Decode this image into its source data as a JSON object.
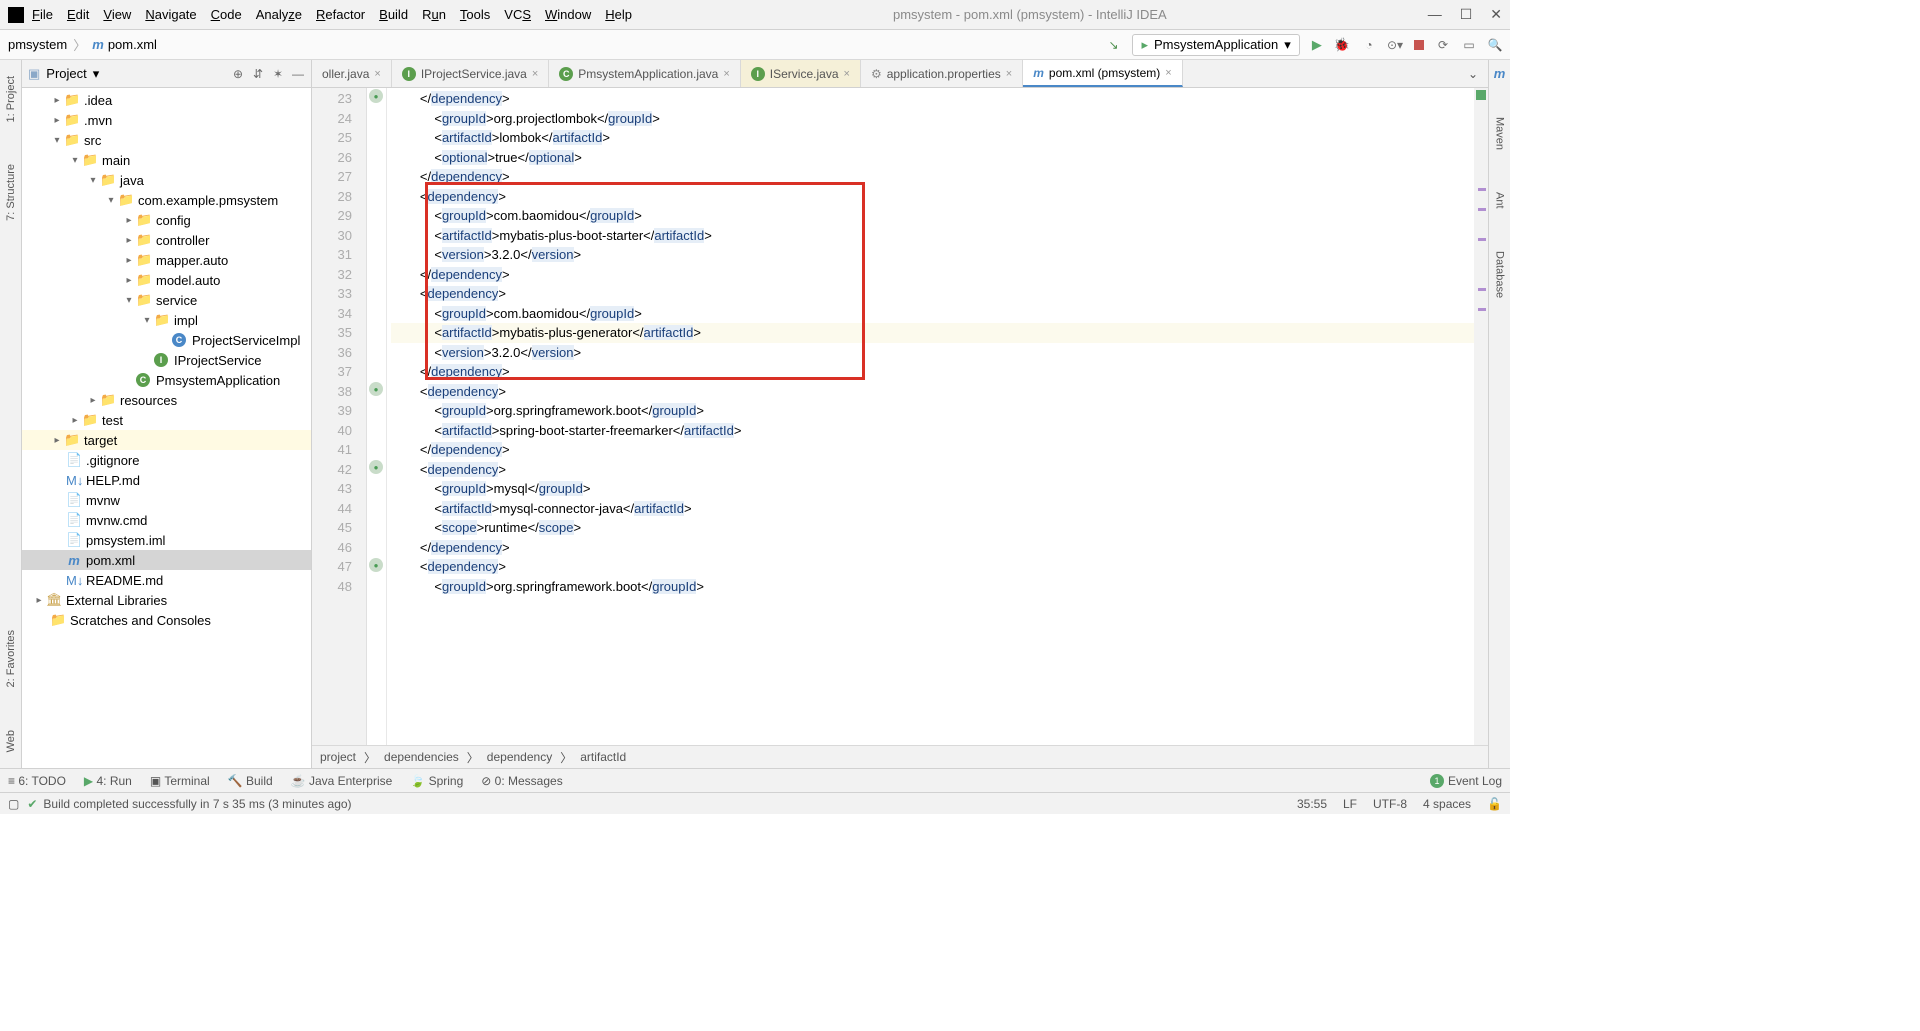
{
  "titlebar": {
    "title": "pmsystem - pom.xml (pmsystem) - IntelliJ IDEA",
    "menus": [
      "File",
      "Edit",
      "View",
      "Navigate",
      "Code",
      "Analyze",
      "Refactor",
      "Build",
      "Run",
      "Tools",
      "VCS",
      "Window",
      "Help"
    ]
  },
  "nav": {
    "crumb1": "pmsystem",
    "crumb2": "pom.xml",
    "run_config": "PmsystemApplication"
  },
  "project_panel": {
    "title": "Project"
  },
  "tree": {
    "idea": ".idea",
    "mvn": ".mvn",
    "src": "src",
    "main": "main",
    "java": "java",
    "pkg": "com.example.pmsystem",
    "config": "config",
    "controller": "controller",
    "mapper": "mapper.auto",
    "model": "model.auto",
    "service": "service",
    "impl": "impl",
    "psi": "ProjectServiceImpl",
    "ips": "IProjectService",
    "app": "PmsystemApplication",
    "resources": "resources",
    "test": "test",
    "target": "target",
    "gitignore": ".gitignore",
    "help": "HELP.md",
    "mvnw": "mvnw",
    "mvnwcmd": "mvnw.cmd",
    "iml": "pmsystem.iml",
    "pom": "pom.xml",
    "readme": "README.md",
    "extlib": "External Libraries",
    "scratch": "Scratches and Consoles"
  },
  "tabs": {
    "t1": "oller.java",
    "t2": "IProjectService.java",
    "t3": "PmsystemApplication.java",
    "t4": "IService.java",
    "t5": "application.properties",
    "t6": "pom.xml (pmsystem)"
  },
  "code_lines": [
    {
      "n": 23,
      "raw": "        </dependency>"
    },
    {
      "n": 24,
      "raw": "            <groupId>org.projectlombok</groupId>"
    },
    {
      "n": 25,
      "raw": "            <artifactId>lombok</artifactId>"
    },
    {
      "n": 26,
      "raw": "            <optional>true</optional>"
    },
    {
      "n": 27,
      "raw": "        </dependency>"
    },
    {
      "n": 28,
      "raw": "        <dependency>"
    },
    {
      "n": 29,
      "raw": "            <groupId>com.baomidou</groupId>"
    },
    {
      "n": 30,
      "raw": "            <artifactId>mybatis-plus-boot-starter</artifactId>"
    },
    {
      "n": 31,
      "raw": "            <version>3.2.0</version>"
    },
    {
      "n": 32,
      "raw": "        </dependency>"
    },
    {
      "n": 33,
      "raw": "        <dependency>"
    },
    {
      "n": 34,
      "raw": "            <groupId>com.baomidou</groupId>"
    },
    {
      "n": 35,
      "raw": "            <artifactId>mybatis-plus-generator</artifactId>",
      "hl": true
    },
    {
      "n": 36,
      "raw": "            <version>3.2.0</version>"
    },
    {
      "n": 37,
      "raw": "        </dependency>"
    },
    {
      "n": 38,
      "raw": "        <dependency>"
    },
    {
      "n": 39,
      "raw": "            <groupId>org.springframework.boot</groupId>"
    },
    {
      "n": 40,
      "raw": "            <artifactId>spring-boot-starter-freemarker</artifactId>"
    },
    {
      "n": 41,
      "raw": "        </dependency>"
    },
    {
      "n": 42,
      "raw": "        <dependency>"
    },
    {
      "n": 43,
      "raw": "            <groupId>mysql</groupId>"
    },
    {
      "n": 44,
      "raw": "            <artifactId>mysql-connector-java</artifactId>"
    },
    {
      "n": 45,
      "raw": "            <scope>runtime</scope>"
    },
    {
      "n": 46,
      "raw": "        </dependency>"
    },
    {
      "n": 47,
      "raw": "        <dependency>"
    },
    {
      "n": 48,
      "raw": "            <groupId>org.springframework.boot</groupId>"
    }
  ],
  "breadcrumb2": {
    "a": "project",
    "b": "dependencies",
    "c": "dependency",
    "d": "artifactId"
  },
  "bottom": {
    "todo": "6: TODO",
    "run": "4: Run",
    "terminal": "Terminal",
    "build": "Build",
    "javaee": "Java Enterprise",
    "spring": "Spring",
    "messages": "0: Messages",
    "eventlog": "Event Log"
  },
  "status": {
    "msg": "Build completed successfully in 7 s 35 ms (3 minutes ago)",
    "pos": "35:55",
    "le": "LF",
    "enc": "UTF-8",
    "indent": "4 spaces"
  },
  "left_tabs": {
    "project": "1: Project",
    "structure": "7: Structure",
    "fav": "2: Favorites",
    "web": "Web"
  },
  "right_tabs": {
    "maven": "Maven",
    "ant": "Ant",
    "db": "Database"
  }
}
